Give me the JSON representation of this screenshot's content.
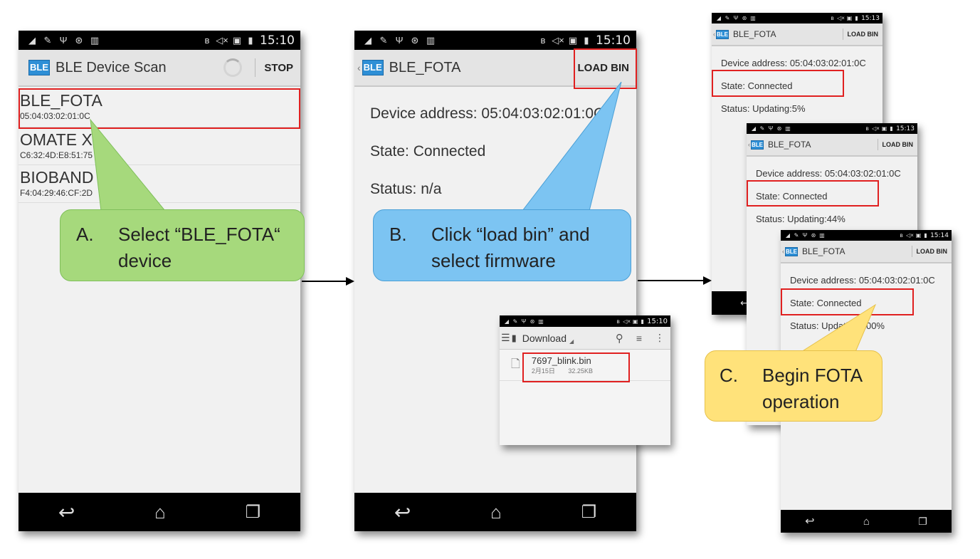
{
  "status_bar": {
    "time_1": "15:10",
    "time_2": "15:10",
    "time_3": "15:13",
    "time_4": "15:13",
    "time_5": "15:14",
    "time_6": "15:10"
  },
  "logo": {
    "text": "BLE"
  },
  "screen_a": {
    "title": "BLE Device Scan",
    "action": "STOP",
    "devices": [
      {
        "name": "BLE_FOTA",
        "address": "05:04:03:02:01:0C"
      },
      {
        "name": "OMATE X",
        "address": "C6:32:4D:E8:51:75"
      },
      {
        "name": "BIOBAND",
        "address": "F4:04:29:46:CF:2D"
      }
    ]
  },
  "screen_b": {
    "title": "BLE_FOTA",
    "action": "LOAD BIN",
    "device_address": "Device address: 05:04:03:02:01:0C",
    "state": "State: Connected",
    "status": "Status: n/a"
  },
  "file_picker": {
    "folder": "Download",
    "file_name": "7697_blink.bin",
    "file_date": "2月15日",
    "file_size": "32.25KB"
  },
  "screen_c1": {
    "title": "BLE_FOTA",
    "action": "LOAD BIN",
    "device_address": "Device address: 05:04:03:02:01:0C",
    "state": "State: Connected",
    "status": "Status: Updating:5%"
  },
  "screen_c2": {
    "title": "BLE_FOTA",
    "action": "LOAD BIN",
    "device_address": "Device address: 05:04:03:02:01:0C",
    "state": "State: Connected",
    "status": "Status: Updating:44%"
  },
  "screen_c3": {
    "title": "BLE_FOTA",
    "action": "LOAD BIN",
    "device_address": "Device address: 05:04:03:02:01:0C",
    "state": "State: Connected",
    "status": "Status: Updating:100%"
  },
  "callouts": {
    "a_num": "A.",
    "a_text": "Select “BLE_FOTA“ device",
    "b_num": "B.",
    "b_text": "Click “load bin” and select firmware",
    "c_num": "C.",
    "c_text": "Begin FOTA operation"
  },
  "icons": {
    "status_left": [
      "broom-icon",
      "wrench-icon",
      "usb-icon",
      "android-debug-icon",
      "barcode-icon"
    ],
    "status_right": [
      "bluetooth-icon",
      "mute-icon",
      "no-sim-icon",
      "battery-charging-icon"
    ],
    "nav": [
      "back-icon",
      "home-icon",
      "recent-apps-icon"
    ]
  },
  "colors": {
    "green_callout": "#a6d97c",
    "blue_callout": "#7cc4f2",
    "yellow_callout": "#ffe27a",
    "highlight_red": "#e02020"
  }
}
